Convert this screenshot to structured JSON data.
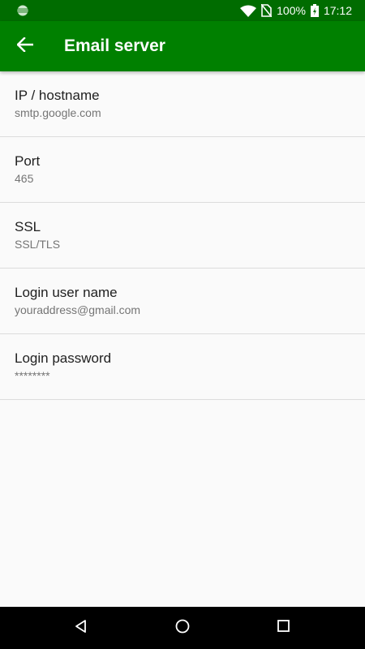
{
  "status_bar": {
    "battery": "100%",
    "time": "17:12"
  },
  "app_bar": {
    "title": "Email server",
    "back_icon": "arrow-back-icon"
  },
  "settings": [
    {
      "title": "IP / hostname",
      "value": "smtp.google.com"
    },
    {
      "title": "Port",
      "value": "465"
    },
    {
      "title": "SSL",
      "value": "SSL/TLS"
    },
    {
      "title": "Login user name",
      "value": "youraddress@gmail.com"
    },
    {
      "title": "Login password",
      "value": "********"
    }
  ],
  "colors": {
    "status_bar": "#006c00",
    "app_bar": "#008000",
    "background": "#fafafa"
  }
}
